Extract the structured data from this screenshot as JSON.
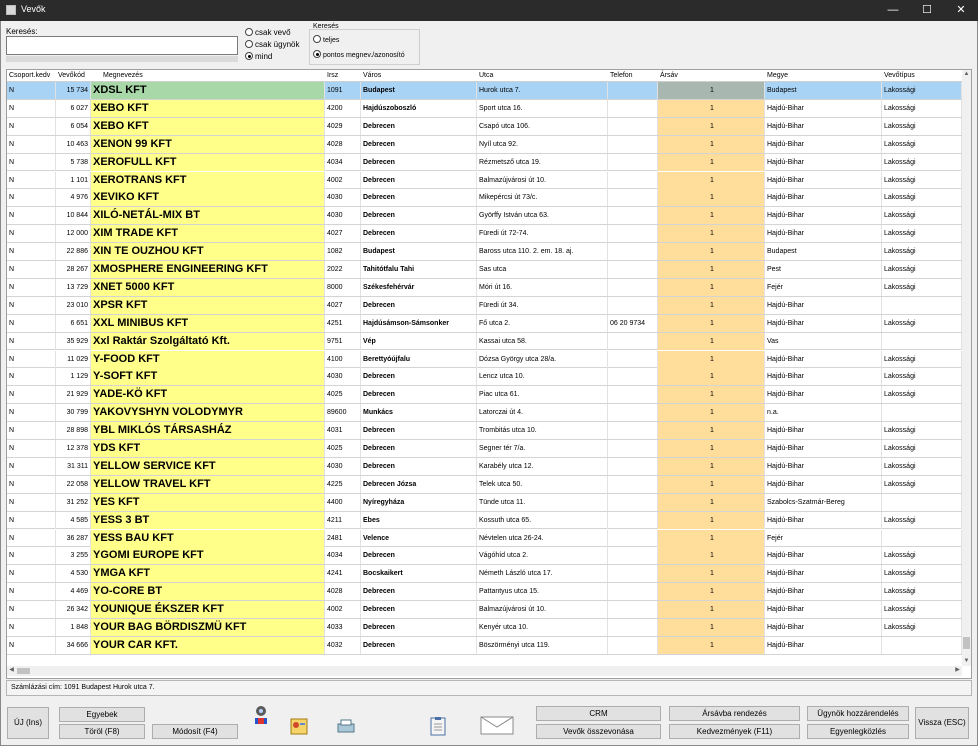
{
  "window": {
    "title": "Vevők"
  },
  "search": {
    "label": "Keresés:",
    "value": ""
  },
  "filter_radios": [
    {
      "label": "csak vevő",
      "checked": false
    },
    {
      "label": "csak ügynök",
      "checked": false
    },
    {
      "label": "mind",
      "checked": true
    }
  ],
  "search_mode": {
    "title": "Keresés",
    "options": [
      {
        "label": "teljes",
        "checked": false
      },
      {
        "label": "pontos megnev./azonosító",
        "checked": true
      }
    ]
  },
  "grid": {
    "columns": [
      "Csoport.kedv",
      "Vevőkód",
      "Megnevezés",
      "Irsz",
      "Város",
      "Utca",
      "Telefon",
      "Ársáv",
      "Megye",
      "Vevőtípus"
    ],
    "rows": [
      [
        "N",
        "15 734",
        "XDSL KFT",
        "1091",
        "Budapest",
        "Hurok utca 7.",
        "",
        "1",
        "Budapest",
        "Lakossági"
      ],
      [
        "N",
        "6 027",
        "XEBO KFT",
        "4200",
        "Hajdúszoboszló",
        "Sport utca 16.",
        "",
        "1",
        "Hajdú-Bihar",
        "Lakossági"
      ],
      [
        "N",
        "6 054",
        "XEBO KFT",
        "4029",
        "Debrecen",
        "Csapó utca 106.",
        "",
        "1",
        "Hajdú-Bihar",
        "Lakossági"
      ],
      [
        "N",
        "10 463",
        "XENON 99 KFT",
        "4028",
        "Debrecen",
        "Nyíl utca 92.",
        "",
        "1",
        "Hajdú-Bihar",
        "Lakossági"
      ],
      [
        "N",
        "5 738",
        "XEROFULL KFT",
        "4034",
        "Debrecen",
        "Rézmetsző utca 19.",
        "",
        "1",
        "Hajdú-Bihar",
        "Lakossági"
      ],
      [
        "N",
        "1 101",
        "XEROTRANS KFT",
        "4002",
        "Debrecen",
        "Balmazújvárosi út 10.",
        "",
        "1",
        "Hajdú-Bihar",
        "Lakossági"
      ],
      [
        "N",
        "4 976",
        "XEVIKO KFT",
        "4030",
        "Debrecen",
        "Mikepércsi út 73/c.",
        "",
        "1",
        "Hajdú-Bihar",
        "Lakossági"
      ],
      [
        "N",
        "10 844",
        "XILÓ-NETÁL-MIX BT",
        "4030",
        "Debrecen",
        "Györffy István utca 63.",
        "",
        "1",
        "Hajdú-Bihar",
        "Lakossági"
      ],
      [
        "N",
        "12 000",
        "XIM TRADE KFT",
        "4027",
        "Debrecen",
        "Füredi út 72-74.",
        "",
        "1",
        "Hajdú-Bihar",
        "Lakossági"
      ],
      [
        "N",
        "22 886",
        "XIN TE OUZHOU KFT",
        "1082",
        "Budapest",
        "Baross utca 110. 2. em. 18. aj.",
        "",
        "1",
        "Budapest",
        "Lakossági"
      ],
      [
        "N",
        "28 267",
        "XMOSPHERE ENGINEERING KFT",
        "2022",
        "Tahitótfalu Tahi",
        "Sas utca",
        "",
        "1",
        "Pest",
        "Lakossági"
      ],
      [
        "N",
        "13 729",
        "XNET 5000 KFT",
        "8000",
        "Székesfehérvár",
        "Móri út 16.",
        "",
        "1",
        "Fejér",
        "Lakossági"
      ],
      [
        "N",
        "23 010",
        "XPSR KFT",
        "4027",
        "Debrecen",
        "Füredi út 34.",
        "",
        "1",
        "Hajdú-Bihar",
        ""
      ],
      [
        "N",
        "6 651",
        "XXL MINIBUS KFT",
        "4251",
        "Hajdúsámson-Sámsonker",
        "Fő utca 2.",
        "06 20 9734",
        "1",
        "Hajdú-Bihar",
        "Lakossági"
      ],
      [
        "N",
        "35 929",
        "Xxl Raktár Szolgáltató Kft.",
        "9751",
        "Vép",
        "Kassai utca 58.",
        "",
        "1",
        "Vas",
        ""
      ],
      [
        "N",
        "11 029",
        "Y-FOOD KFT",
        "4100",
        "Berettyóújfalu",
        "Dózsa György utca 28/a.",
        "",
        "1",
        "Hajdú-Bihar",
        "Lakossági"
      ],
      [
        "N",
        "1 129",
        "Y-SOFT KFT",
        "4030",
        "Debrecen",
        "Lencz utca 10.",
        "",
        "1",
        "Hajdú-Bihar",
        "Lakossági"
      ],
      [
        "N",
        "21 929",
        "YADE-KÖ KFT",
        "4025",
        "Debrecen",
        "Piac utca 61.",
        "",
        "1",
        "Hajdú-Bihar",
        "Lakossági"
      ],
      [
        "N",
        "30 799",
        "YAKOVYSHYN VOLODYMYR",
        "89600",
        "Munkács",
        "Latorczai út 4.",
        "",
        "1",
        "n.a.",
        ""
      ],
      [
        "N",
        "28 898",
        "YBL MIKLÓS TÁRSASHÁZ",
        "4031",
        "Debrecen",
        "Trombitás utca 10.",
        "",
        "1",
        "Hajdú-Bihar",
        "Lakossági"
      ],
      [
        "N",
        "12 378",
        "YDS KFT",
        "4025",
        "Debrecen",
        "Segner tér 7/a.",
        "",
        "1",
        "Hajdú-Bihar",
        "Lakossági"
      ],
      [
        "N",
        "31 311",
        "YELLOW SERVICE KFT",
        "4030",
        "Debrecen",
        "Karabély utca 12.",
        "",
        "1",
        "Hajdú-Bihar",
        "Lakossági"
      ],
      [
        "N",
        "22 058",
        "YELLOW TRAVEL KFT",
        "4225",
        "Debrecen Józsa",
        "Telek utca 50.",
        "",
        "1",
        "Hajdú-Bihar",
        "Lakossági"
      ],
      [
        "N",
        "31 252",
        "YES KFT",
        "4400",
        "Nyíregyháza",
        "Tünde utca 11.",
        "",
        "1",
        "Szabolcs-Szatmár-Bereg",
        ""
      ],
      [
        "N",
        "4 585",
        "YESS 3 BT",
        "4211",
        "Ebes",
        "Kossuth utca 65.",
        "",
        "1",
        "Hajdú-Bihar",
        "Lakossági"
      ],
      [
        "N",
        "36 287",
        "YESS BAU KFT",
        "2481",
        "Velence",
        "Névtelen utca 26-24.",
        "",
        "1",
        "Fejér",
        ""
      ],
      [
        "N",
        "3 255",
        "YGOMI EUROPE KFT",
        "4034",
        "Debrecen",
        "Vágóhíd utca 2.",
        "",
        "1",
        "Hajdú-Bihar",
        "Lakossági"
      ],
      [
        "N",
        "4 530",
        "YMGA KFT",
        "4241",
        "Bocskaikert",
        "Németh László utca 17.",
        "",
        "1",
        "Hajdú-Bihar",
        "Lakossági"
      ],
      [
        "N",
        "4 469",
        "YO-CORE BT",
        "4028",
        "Debrecen",
        "Pattantyus utca 15.",
        "",
        "1",
        "Hajdú-Bihar",
        "Lakossági"
      ],
      [
        "N",
        "26 342",
        "YOUNIQUE ÉKSZER KFT",
        "4002",
        "Debrecen",
        "Balmazújvárosi út 10.",
        "",
        "1",
        "Hajdú-Bihar",
        "Lakossági"
      ],
      [
        "N",
        "1 848",
        "YOUR BAG BÖRDISZMÜ KFT",
        "4033",
        "Debrecen",
        "Kenyér utca 10.",
        "",
        "1",
        "Hajdú-Bihar",
        "Lakossági"
      ],
      [
        "N",
        "34 666",
        "YOUR CAR KFT.",
        "4032",
        "Debrecen",
        "Böszörményi utca 119.",
        "",
        "1",
        "Hajdú-Bihar",
        ""
      ]
    ]
  },
  "status": {
    "text": "Számlázási cím: 1091 Budapest Hurok utca 7."
  },
  "buttons": {
    "new": "ÚJ (Ins)",
    "other": "Egyebek",
    "delete": "Töröl (F8)",
    "modify": "Módosít (F4)",
    "crm": "CRM",
    "merge": "Vevők összevonása",
    "price_band": "Ársávba rendezés",
    "discounts": "Kedvezmények (F11)",
    "assign_agent": "Ügynök hozzárendelés",
    "balance": "Egyenlegközlés",
    "back": "Vissza (ESC)"
  },
  "colors": {
    "name_column": "#ffff8a",
    "price_band_column": "#ffdd9a",
    "selected_row": "#a9d3f5"
  }
}
